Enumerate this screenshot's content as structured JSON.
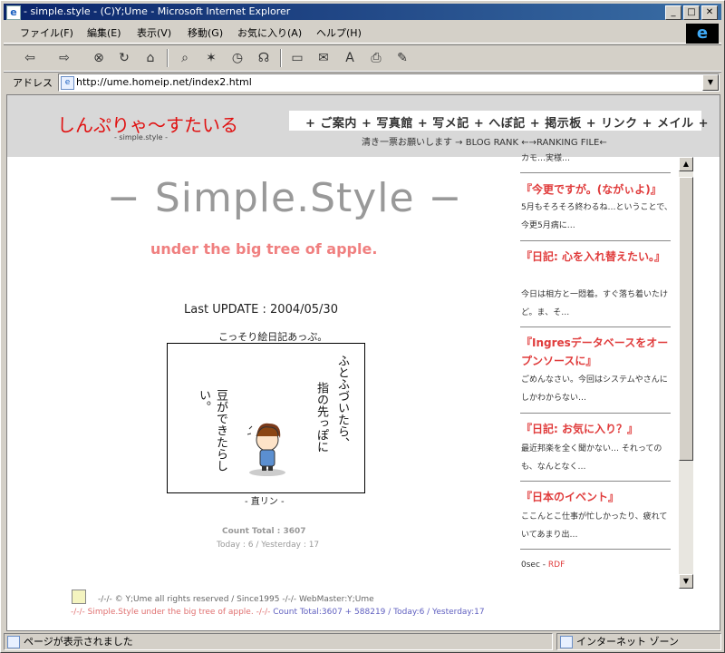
{
  "window": {
    "title": "- simple.style - (C)Y;Ume - Microsoft Internet Explorer",
    "ie_icon": "e"
  },
  "menu": [
    "ファイル(F)",
    "編集(E)",
    "表示(V)",
    "移動(G)",
    "お気に入り(A)",
    "ヘルプ(H)"
  ],
  "toolbar": {
    "back": "⇦",
    "forward": "⇨",
    "stop": "⊗",
    "refresh": "↻",
    "home": "⌂",
    "search": "⌕",
    "favorites": "✶",
    "history": "◷",
    "channels": "☊",
    "fullscreen": "▭",
    "mail": "✉",
    "fonts": "A",
    "print": "⎙",
    "edit": "✎"
  },
  "address": {
    "label": "アドレス",
    "url": "http://ume.homeip.net/index2.html"
  },
  "header": {
    "site_name": "しんぷりゃ〜すたいる",
    "sub_name": "- simple.style -",
    "nav": "+ ご案内 + 写真館 + 写メ記 + へぼ記 + 掲示板 + リンク + メイル +",
    "rank": "清き一票お願いします → BLOG RANK ←→RANKING FILE←"
  },
  "main": {
    "title": "− Simple.Style −",
    "tagline": "under the big tree of apple.",
    "last_update": "Last UPDATE : 2004/05/30",
    "comic_caption": "こっそり絵日記あっぷ。",
    "comic_text_1": "ふとふづいたら、",
    "comic_text_2": "指の先っぽに",
    "comic_text_3": "豆ができたらしい。",
    "credit": "- 直リン -",
    "count": "Count Total : 3607",
    "today": "Today : 6 / Yesterday : 17"
  },
  "sidebar": {
    "top_body": "カモ…実様…",
    "entries": [
      {
        "title": "『今更ですが。(ながぃよ)』",
        "body": "5月もそろそろ終わるね…ということで、今更5月病に…"
      },
      {
        "title": "『日記: 心を入れ替えたい。』",
        "body": "今日は相方と一悶着。すぐ落ち着いたけど。ま、そ…"
      },
      {
        "title": "『Ingresデータベースをオープンソースに』",
        "body": "ごめんなさい。今回はシステムやさんにしかわからない…"
      },
      {
        "title": "『日記: お気に入り？』",
        "body": "最近邦楽を全く聞かない…  それってのも、なんとなく…"
      },
      {
        "title": "『日本のイベント』",
        "body": "ここんとこ仕事が忙しかったり、疲れていてあまり出…"
      }
    ],
    "rdf_label": "0sec -",
    "rdf_link": "RDF"
  },
  "footer": {
    "line1": "-/-/- © Y;Ume all rights reserved / Since1995 -/-/- WebMaster:Y;Ume",
    "line2_a": "-/-/- Simple.Style under the big tree of apple. -/-/-",
    "line2_b": "Count Total:3607 + 588219 / Today:6 / Yesterday:17"
  },
  "statusbar": {
    "left": "ページが表示されました",
    "right": "インターネット ゾーン"
  },
  "colors": {
    "accent": "#e01010",
    "link": "#e03c3c",
    "tagline": "#f08080",
    "footer_blue": "#6060c0"
  }
}
